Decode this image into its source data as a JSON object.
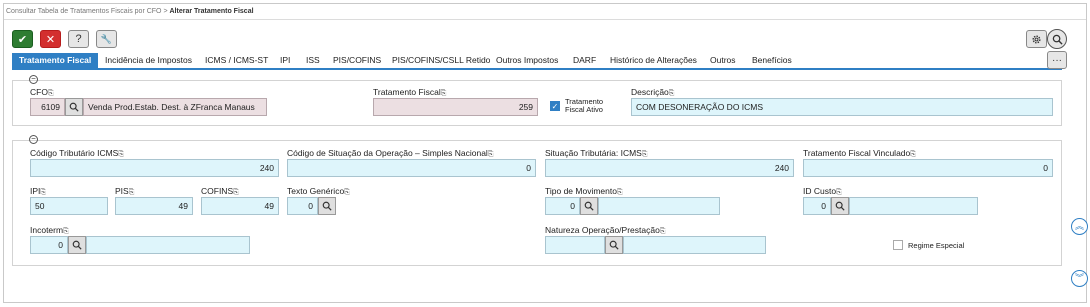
{
  "breadcrumb": {
    "parent": "Consultar Tabela de Tratamentos Fiscais por CFO",
    "separator": ">",
    "current": "Alterar Tratamento Fiscal"
  },
  "toolbar": {
    "ok": "✔",
    "cancel": "✕",
    "help": "?",
    "tools": "🔧"
  },
  "tabs": [
    "Tratamento Fiscal",
    "Incidência de Impostos",
    "ICMS / ICMS-ST",
    "IPI",
    "ISS",
    "PIS/COFINS",
    "PIS/COFINS/CSLL Retido",
    "Outros Impostos",
    "DARF",
    "Histórico de Alterações",
    "Outros",
    "Benefícios"
  ],
  "active_tab": "Tratamento Fiscal",
  "more_label": "···",
  "section1": {
    "collapse": "−",
    "cfo": {
      "label": "CFO",
      "code": "6109",
      "description": "Venda Prod.Estab. Dest. à ZFranca Manaus"
    },
    "tratamento_fiscal": {
      "label": "Tratamento Fiscal",
      "value": "259"
    },
    "ativo": {
      "label_line1": "Tratamento",
      "label_line2": "Fiscal Ativo",
      "checked": true
    },
    "descricao": {
      "label": "Descrição",
      "value": "COM DESONERAÇÃO DO ICMS"
    }
  },
  "section2": {
    "collapse": "−",
    "codigo_tributario": {
      "label": "Código Tributário ICMS",
      "value": "240"
    },
    "cod_situacao": {
      "label": "Código de Situação da Operação – Simples Nacional",
      "value": "0"
    },
    "situacao_tributaria": {
      "label": "Situação Tributária: ICMS",
      "value": "240"
    },
    "trat_vinculado": {
      "label": "Tratamento Fiscal Vinculado",
      "value": "0"
    },
    "ipi": {
      "label": "IPI",
      "value": "50"
    },
    "pis": {
      "label": "PIS",
      "value": "49"
    },
    "cofins": {
      "label": "COFINS",
      "value": "49"
    },
    "texto_generico": {
      "label": "Texto Genérico",
      "value": "0"
    },
    "tipo_movimento": {
      "label": "Tipo de Movimento",
      "value": "0"
    },
    "id_custo": {
      "label": "ID Custo",
      "value": "0"
    },
    "incoterm": {
      "label": "Incoterm",
      "value": "0"
    },
    "natureza": {
      "label": "Natureza Operação/Prestação",
      "value": ""
    },
    "regime_especial": {
      "label": "Regime Especial",
      "checked": false
    }
  },
  "pin_glyph": "⎘",
  "side": {
    "up": "︽",
    "down": "︾"
  },
  "colors": {
    "accent": "#2f7fc4",
    "ok": "#2e7d32",
    "cancel": "#d32f2f",
    "editable_bg": "#def5fb",
    "readonly_bg": "#ecdfe2"
  }
}
